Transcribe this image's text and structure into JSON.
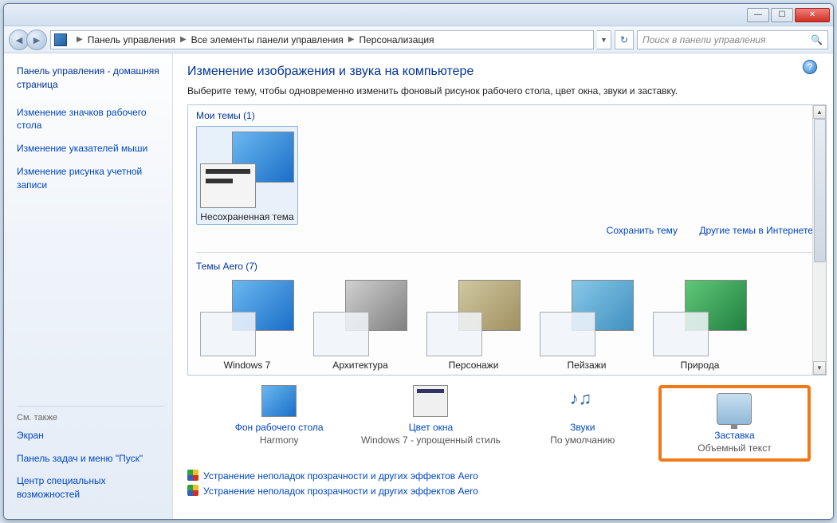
{
  "titlebar": {
    "minimize": "—",
    "maximize": "☐",
    "close": "✕"
  },
  "nav": {
    "back": "◄",
    "forward": "►",
    "breadcrumb": {
      "seg1": "Панель управления",
      "seg2": "Все элементы панели управления",
      "seg3": "Персонализация"
    },
    "dropdown": "▼",
    "refresh": "↻",
    "search_placeholder": "Поиск в панели управления",
    "search_icon": "🔍"
  },
  "help": "?",
  "sidebar": {
    "home": "Панель управления - домашняя страница",
    "links": [
      "Изменение значков рабочего стола",
      "Изменение указателей мыши",
      "Изменение рисунка учетной записи"
    ],
    "see_also_label": "См. также",
    "see_also": [
      "Экран",
      "Панель задач и меню \"Пуск\"",
      "Центр специальных возможностей"
    ]
  },
  "main": {
    "heading": "Изменение изображения и звука на компьютере",
    "subtitle": "Выберите тему, чтобы одновременно изменить фоновый рисунок рабочего стола, цвет окна, звуки и заставку.",
    "my_themes_label": "Мои темы (1)",
    "my_themes": [
      {
        "name": "Несохраненная тема"
      }
    ],
    "save_theme": "Сохранить тему",
    "more_themes": "Другие темы в Интернете",
    "aero_label": "Темы Aero (7)",
    "aero_themes": [
      {
        "name": "Windows 7"
      },
      {
        "name": "Архитектура"
      },
      {
        "name": "Персонажи"
      },
      {
        "name": "Пейзажи"
      },
      {
        "name": "Природа"
      }
    ],
    "actions": {
      "bg": {
        "label": "Фон рабочего стола",
        "sub": "Harmony"
      },
      "color": {
        "label": "Цвет окна",
        "sub": "Windows 7 - упрощенный стиль"
      },
      "sounds": {
        "label": "Звуки",
        "sub": "По умолчанию"
      },
      "saver": {
        "label": "Заставка",
        "sub": "Объемный текст"
      }
    },
    "troubleshoot": "Устранение неполадок прозрачности и других эффектов Aero",
    "scroll_up": "▲",
    "scroll_down": "▼"
  }
}
